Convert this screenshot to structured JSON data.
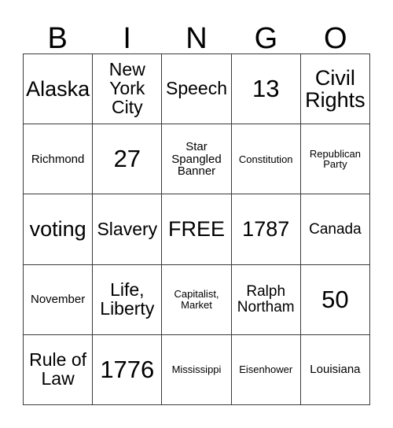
{
  "card": {
    "title": "BINGO Card",
    "header_letters": [
      "B",
      "I",
      "N",
      "G",
      "O"
    ],
    "free_space_label": "FREE",
    "rows": [
      [
        {
          "text": "Alaska",
          "size": "lg"
        },
        {
          "text": "New York City",
          "size": "md"
        },
        {
          "text": "Speech",
          "size": "md"
        },
        {
          "text": "13",
          "size": "xl"
        },
        {
          "text": "Civil Rights",
          "size": "lg"
        }
      ],
      [
        {
          "text": "Richmond",
          "size": "xs"
        },
        {
          "text": "27",
          "size": "xl"
        },
        {
          "text": "Star Spangled Banner",
          "size": "xs"
        },
        {
          "text": "Constitution",
          "size": "xxs"
        },
        {
          "text": "Republican Party",
          "size": "xxs"
        }
      ],
      [
        {
          "text": "voting",
          "size": "lg"
        },
        {
          "text": "Slavery",
          "size": "md"
        },
        {
          "text": "FREE",
          "size": "lg"
        },
        {
          "text": "1787",
          "size": "lg"
        },
        {
          "text": "Canada",
          "size": "sm"
        }
      ],
      [
        {
          "text": "November",
          "size": "xs"
        },
        {
          "text": "Life, Liberty",
          "size": "md"
        },
        {
          "text": "Capitalist, Market",
          "size": "xxs"
        },
        {
          "text": "Ralph Northam",
          "size": "sm"
        },
        {
          "text": "50",
          "size": "xl"
        }
      ],
      [
        {
          "text": "Rule of Law",
          "size": "md"
        },
        {
          "text": "1776",
          "size": "xl"
        },
        {
          "text": "Mississippi",
          "size": "xxs"
        },
        {
          "text": "Eisenhower",
          "size": "xxs"
        },
        {
          "text": "Louisiana",
          "size": "xs"
        }
      ]
    ],
    "colors": {
      "background": "#ffffff",
      "text": "#000000",
      "grid_line": "#3a3a3a"
    }
  }
}
